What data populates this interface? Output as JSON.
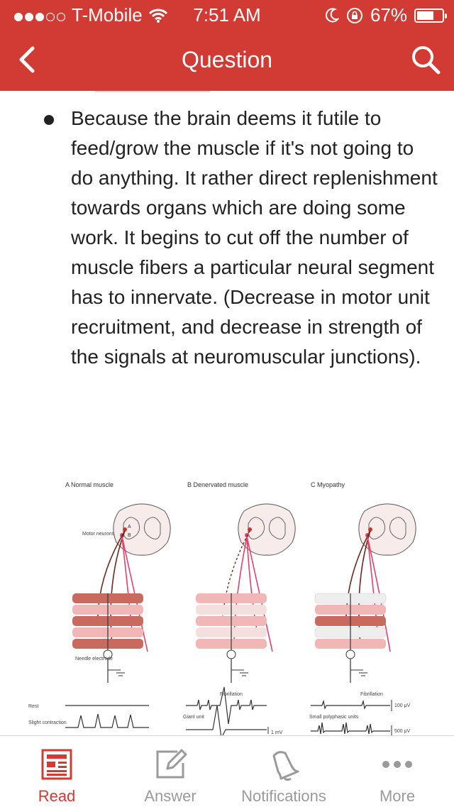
{
  "status_bar": {
    "carrier": "T-Mobile",
    "time": "7:51 AM",
    "battery": "67%",
    "battery_level": 0.67,
    "signal_bars": 3
  },
  "nav": {
    "title": "Question"
  },
  "content": {
    "bullet_text": "Because the brain deems it futile to feed/grow the muscle if it's not going to do anything. It rather direct replenishment towards organs which are doing some work. It begins to cut off the number of muscle fibers a particular neural segment has to innervate. (Decrease in motor unit recruitment, and decrease in strength of the signals at neuromuscular junctions)."
  },
  "figure": {
    "panel_a": "A  Normal muscle",
    "panel_b": "B  Denervated muscle",
    "panel_c": "C  Myopathy",
    "motor_neurons": "Motor neurons",
    "needle_electrode": "Needle electrode",
    "label_a": "A",
    "label_b": "B",
    "rest": "Rest",
    "slight_contraction": "Slight contraction",
    "fibrillation": "Fibrillation",
    "giant_unit": "Giant unit",
    "small_polyphasic": "Small polyphasic units",
    "scale_1mv": "1 mV",
    "scale_100uv": "100 μV",
    "scale_500uv": "500 μV"
  },
  "tabs": [
    {
      "label": "Read",
      "active": true,
      "icon": "newspaper-icon"
    },
    {
      "label": "Answer",
      "active": false,
      "icon": "edit-icon"
    },
    {
      "label": "Notifications",
      "active": false,
      "icon": "bell-icon"
    },
    {
      "label": "More",
      "active": false,
      "icon": "more-dots-icon"
    }
  ],
  "colors": {
    "accent": "#d23b34",
    "inactive_tab": "#9a9a9a",
    "muscle_red": "#c96a5e",
    "nerve_pink": "#e0426d"
  }
}
